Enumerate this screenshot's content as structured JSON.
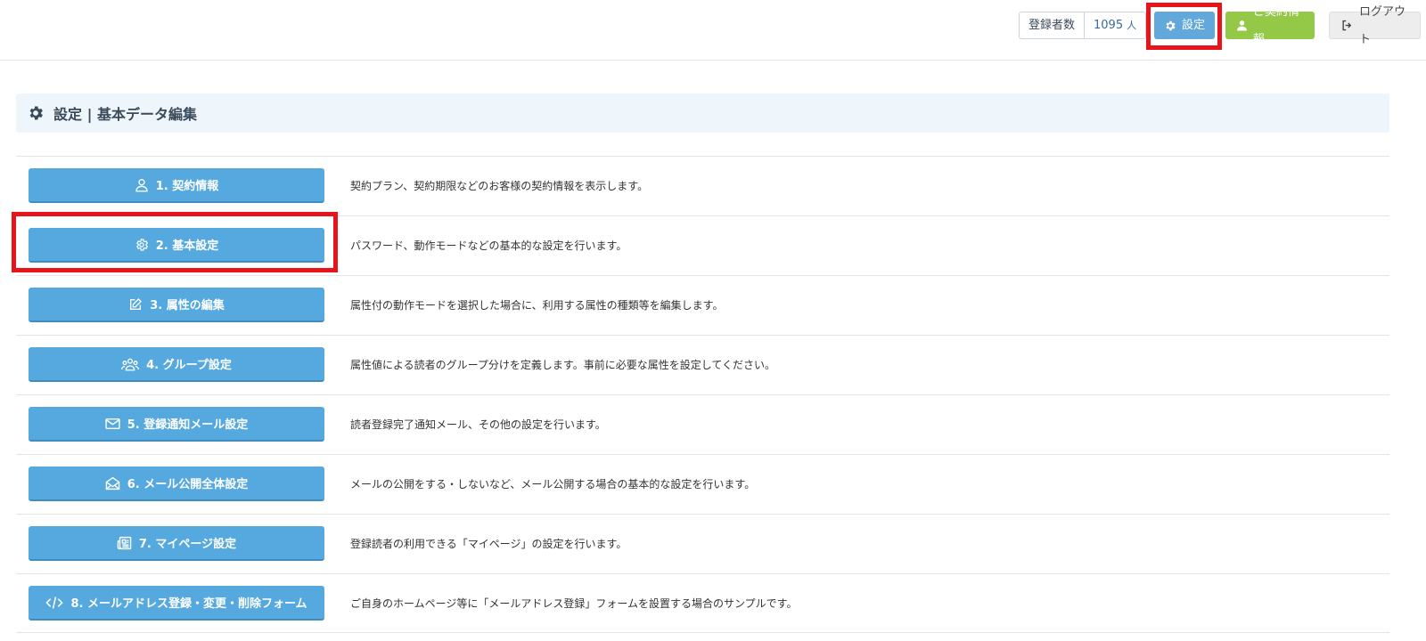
{
  "header": {
    "registered_label": "登録者数",
    "registered_count": "1095",
    "registered_unit": "人",
    "settings_label": "設定",
    "contract_label": "ご契約情報",
    "logout_label": "ログアウト"
  },
  "section": {
    "title": "設定 | 基本データ編集"
  },
  "items": [
    {
      "label": "1. 契約情報",
      "icon": "user-icon",
      "desc": "契約プラン、契約期限などのお客様の契約情報を表示します。"
    },
    {
      "label": "2. 基本設定",
      "icon": "gear-icon",
      "desc": "パスワード、動作モードなどの基本的な設定を行います。"
    },
    {
      "label": "3. 属性の編集",
      "icon": "edit-icon",
      "desc": "属性付の動作モードを選択した場合に、利用する属性の種類等を編集します。"
    },
    {
      "label": "4. グループ設定",
      "icon": "group-icon",
      "desc": "属性値による読者のグループ分けを定義します。事前に必要な属性を設定してください。"
    },
    {
      "label": "5. 登録通知メール設定",
      "icon": "envelope-icon",
      "desc": "読者登録完了通知メール、その他の設定を行います。"
    },
    {
      "label": "6. メール公開全体設定",
      "icon": "open-envelope-icon",
      "desc": "メールの公開をする・しないなど、メール公開する場合の基本的な設定を行います。"
    },
    {
      "label": "7. マイページ設定",
      "icon": "newspaper-icon",
      "desc": "登録読者の利用できる「マイページ」の設定を行います。"
    },
    {
      "label": "8. メールアドレス登録・変更・削除フォーム",
      "icon": "code-icon",
      "desc": "ご自身のホームページ等に「メールアドレス登録」フォームを設置する場合のサンプルです。"
    }
  ]
}
